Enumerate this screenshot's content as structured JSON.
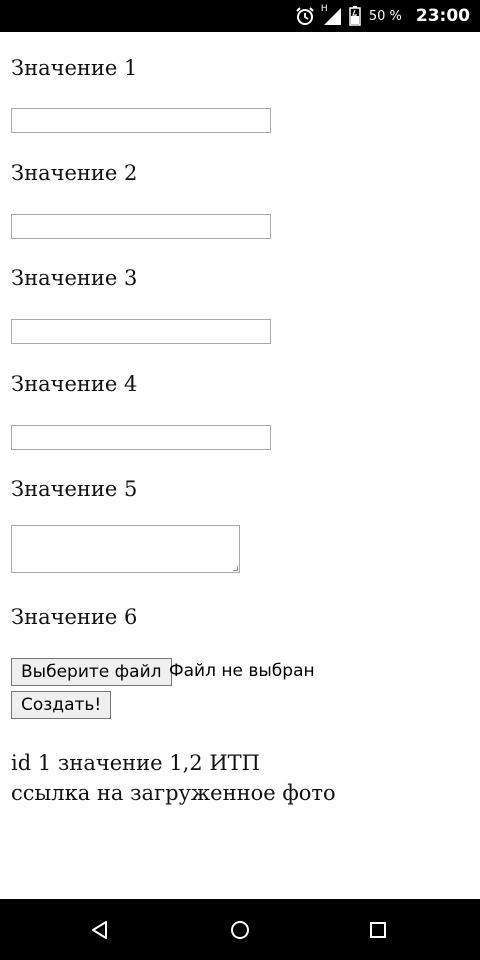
{
  "status_bar": {
    "icons": [
      "alarm-icon",
      "signal-icon",
      "battery-icon"
    ],
    "network_label": "H",
    "battery_text": "50 %",
    "time": "23:00"
  },
  "form": {
    "fields": [
      {
        "label": "Значение 1",
        "value": ""
      },
      {
        "label": "Значение 2",
        "value": ""
      },
      {
        "label": "Значение 3",
        "value": ""
      },
      {
        "label": "Значение 4",
        "value": ""
      },
      {
        "label": "Значение 5",
        "value": ""
      },
      {
        "label": "Значение 6"
      }
    ],
    "file_button_label": "Выберите файл",
    "file_status": "Файл не выбран",
    "submit_label": "Создать!"
  },
  "output": {
    "line1": "id 1 значение 1,2 ИТП",
    "line2": "ссылка на загруженное фото"
  },
  "nav_bar": {
    "icons": [
      "back-icon",
      "home-icon",
      "recents-icon"
    ]
  }
}
